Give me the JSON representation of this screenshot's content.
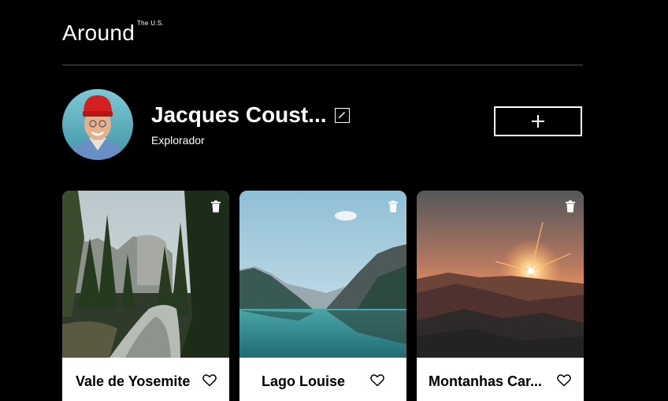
{
  "header": {
    "logo_text": "Around",
    "logo_sup": "The U.S."
  },
  "profile": {
    "name": "Jacques Coust...",
    "about": "Explorador",
    "edit_icon": "pencil-icon",
    "add_icon": "plus-icon"
  },
  "cards": [
    {
      "title": "Vale de Yosemite",
      "image_icon": "photo-yosemite-valley"
    },
    {
      "title": "Lago Louise",
      "image_icon": "photo-lake-louise"
    },
    {
      "title": "Montanhas Car...",
      "image_icon": "photo-sunset-mountains"
    }
  ],
  "colors": {
    "background": "#000000",
    "text": "#ffffff",
    "divider": "#545454",
    "card_text": "#000000",
    "avatar_hat": "#d42020"
  }
}
